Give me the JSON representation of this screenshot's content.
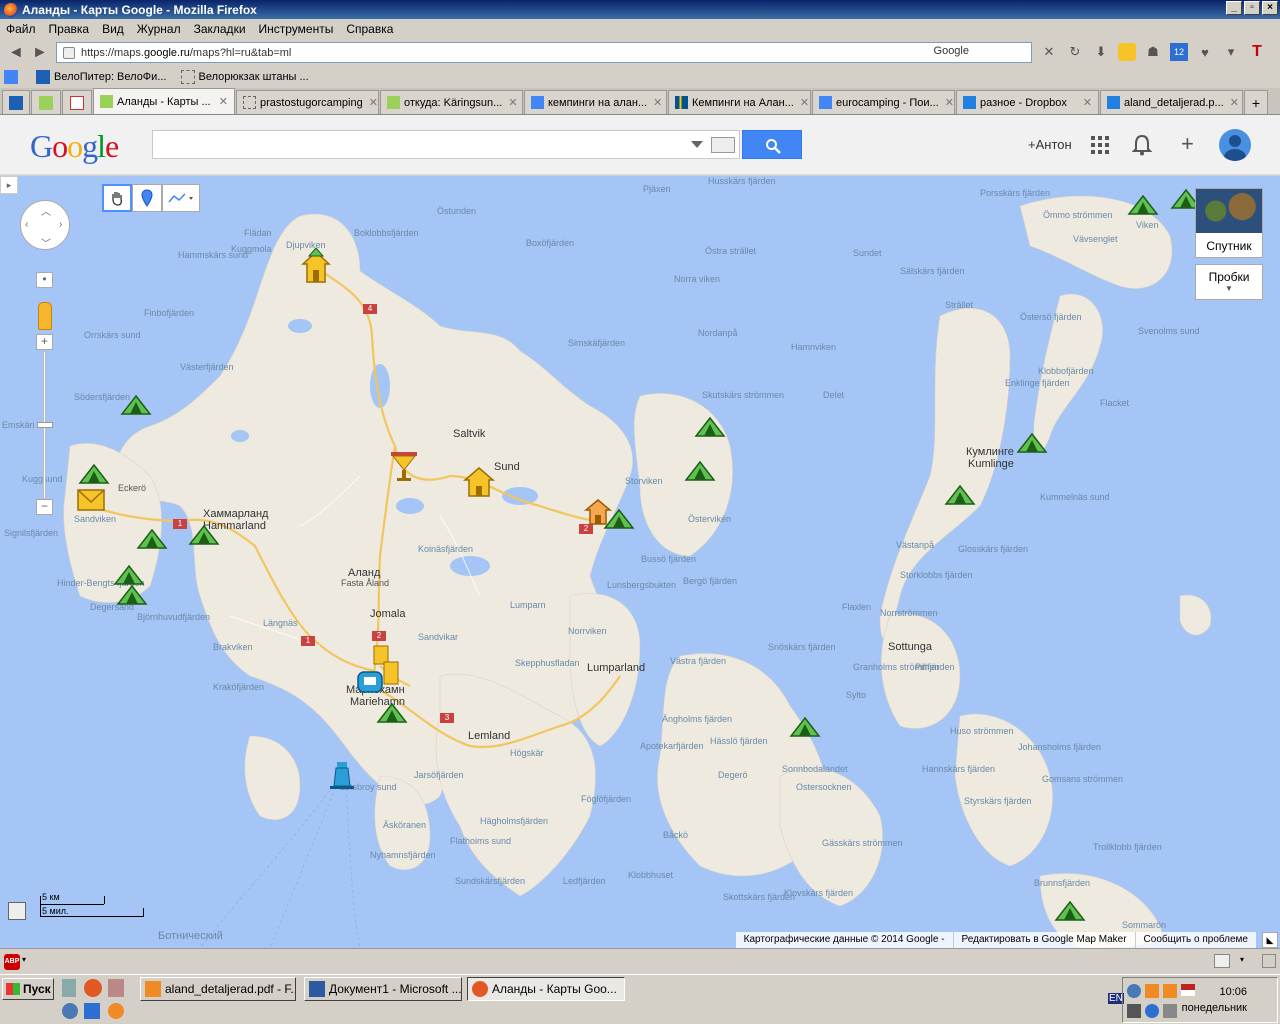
{
  "window": {
    "title": "Аланды - Карты Google - Mozilla Firefox"
  },
  "menu": [
    "Файл",
    "Правка",
    "Вид",
    "Журнал",
    "Закладки",
    "Инструменты",
    "Справка"
  ],
  "urlbar": {
    "prefix": "https://maps.",
    "host": "google.ru",
    "path": "/maps?hl=ru&tab=ml",
    "search_engine": "Google"
  },
  "bookmarks": [
    {
      "label": "ВелоПитер: ВелоФи..."
    },
    {
      "label": "Велорюкзак штаны ..."
    }
  ],
  "tabs": [
    {
      "label": "Аланды - Карты ...",
      "active": true
    },
    {
      "label": "prastostugorcamping"
    },
    {
      "label": "откуда: Käringsun..."
    },
    {
      "label": "кемпинги на алан..."
    },
    {
      "label": "Кемпинги на Алан..."
    },
    {
      "label": "eurocamping - Пои..."
    },
    {
      "label": "разное - Dropbox"
    },
    {
      "label": "aland_detaljerad.p..."
    }
  ],
  "google": {
    "user": "+Антон"
  },
  "map": {
    "satellite_label": "Спутник",
    "traffic_label": "Пробки",
    "scale_km": "5 км",
    "scale_mi": "5 мил.",
    "attribution": "Картографические данные © 2014 Google -",
    "edit_link": "Редактировать в Google Map Maker",
    "report_link": "Сообщить о проблеме",
    "towns": {
      "saltvik": "Saltvik",
      "sund": "Sund",
      "hammarland_ru": "Хаммарланд",
      "hammarland": "Hammarland",
      "aland_ru": "Аланд",
      "fasta_aland": "Fasta Åland",
      "jomala": "Jomala",
      "mariehamn_ru": "Мариехамн",
      "mariehamn": "Mariehamn",
      "lemland": "Lemland",
      "lumparland": "Lumparland",
      "sottunga": "Sottunga",
      "kumlinge_ru": "Кумлинге",
      "kumlinge": "Kumlinge",
      "eckero": "Eckerö",
      "sea": "Ботнический"
    },
    "water": {
      "w1": "Pjäxen",
      "w2": "Husskärs fjärden",
      "w3": "Boxöfjärden",
      "w4": "Östra strället",
      "w5": "Sundet",
      "w6": "Porsskärs fjärden",
      "w7": "Vävsenglet",
      "w8": "Viken",
      "w9": "Ömmo strömmen",
      "w10": "Sälskärs fjärden",
      "w11": "Strället",
      "w12": "Östersö fjärden",
      "w13": "Svenolms sund",
      "w14": "Hamnviken",
      "w15": "Nordanpå",
      "w16": "Simskäfjärden",
      "w17": "Norra viken",
      "w18": "Delet",
      "w19": "Skutskärs strömmen",
      "w20": "Flacket",
      "w21": "Klobbofjärden",
      "w22": "Enklinge fjärden",
      "w23": "Kummelnäs sund",
      "w24": "Storviken",
      "w25": "Östervikén",
      "w26": "Västanpå",
      "w27": "Glosskärs fjärden",
      "w28": "Storklobbs fjärden",
      "w29": "Norrströmmen",
      "w30": "Lumparn",
      "w31": "Norrviken",
      "w32": "Västra fjärden",
      "w33": "Bussö fjärden",
      "w34": "Lunsbergsbukten",
      "w35": "Bergö fjärden",
      "w36": "Flaxlen",
      "w37": "Skepphusfladan",
      "w38": "Sandvikar",
      "w39": "Koinäsfjärden",
      "w40": "Pillfjärden",
      "w41": "Granholms strömmen",
      "w42": "Sylto",
      "w43": "Snöskärs fjärden",
      "w44": "Ängholms fjärden",
      "w45": "Apotekarfjärden",
      "w46": "Hässlö fjärden",
      "w47": "Degerö",
      "w48": "Sonnbodalandet",
      "w49": "Ostersocknen",
      "w50": "Huso strömmen",
      "w51": "Johansholms fjärden",
      "w52": "Hannskärs fjärden",
      "w53": "Gomsans strömmen",
      "w54": "Styrskärs fjärden",
      "w55": "Ledfjärden",
      "w56": "Föglöfjärden",
      "w57": "Björnhuvudfjärden",
      "w58": "Hinder-Bengts fjärden",
      "w59": "Degersand",
      "w60": "Sandviken",
      "w61": "Kraköfjärden",
      "w62": "Brakviken",
      "w63": "Längnäs",
      "w64": "Västerfjärden",
      "w65": "Södersfjärden",
      "w66": "Orrskärs sund",
      "w67": "Finbofjärden",
      "w68": "Hammskärs sund",
      "w69": "Kuggmola",
      "w70": "Flädan",
      "w71": "Djupviken",
      "w72": "Boklobbsfjärden",
      "w73": "Östunden",
      "w74": "Jarsöfjärden",
      "w75": "Lotsbroy sund",
      "w76": "Äsköranen",
      "w77": "Hägholmsfjärden",
      "w78": "Flathoims sund",
      "w79": "Nyhamnsfjärden",
      "w80": "Sundskärsfjärden",
      "w81": "Högskär",
      "w82": "Båckö",
      "w83": "Klobbhuset",
      "w84": "Skottskärs fjärden",
      "w85": "Klovskärs fjärden",
      "w86": "Gässkärs strömmen",
      "w87": "Trollklobb fjärden",
      "w88": "Brunnsfjärden",
      "w89": "Sommarön",
      "w90": "Kuggsund",
      "w91": "Emskäri",
      "w92": "Signilsfjärden"
    },
    "roads": [
      "4",
      "1",
      "2",
      "3",
      "1",
      "2"
    ]
  },
  "statusbar": {
    "abp": "ABP"
  },
  "taskbar": {
    "start": "Пуск",
    "items": [
      {
        "label": "aland_detaljerad.pdf - F..."
      },
      {
        "label": "Документ1 - Microsoft ..."
      },
      {
        "label": "Аланды - Карты Goo...",
        "active": true
      }
    ],
    "lang": "EN",
    "time": "10:06",
    "day": "понедельник"
  }
}
